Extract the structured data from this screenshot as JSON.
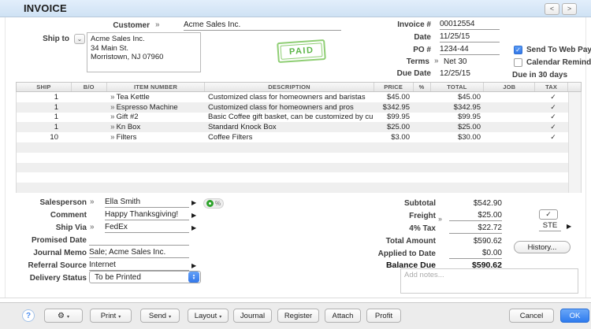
{
  "titlebar": {
    "title": "INVOICE"
  },
  "glyphs": {
    "zoom": "»",
    "detail": "▶",
    "caret": "▾",
    "chevron": "⌄",
    "check": "✓",
    "gear": "⚙",
    "percent": "%",
    "help": "?",
    "nav_prev": "<",
    "nav_next": ">",
    "step_up": "▲",
    "step_down": "▼"
  },
  "header": {
    "customer": {
      "label": "Customer",
      "value": "Acme Sales Inc."
    },
    "ship_to": {
      "label": "Ship to",
      "value": "Acme Sales Inc.\n34 Main St.\nMorristown, NJ 07960"
    },
    "paid_stamp": "PAID",
    "invoice_no": {
      "label": "Invoice #",
      "value": "00012554"
    },
    "date": {
      "label": "Date",
      "value": "11/25/15"
    },
    "po": {
      "label": "PO #",
      "value": "1234-44"
    },
    "terms": {
      "label": "Terms",
      "value": "Net 30"
    },
    "due_date": {
      "label": "Due Date",
      "value": "12/25/15"
    },
    "web_pay": {
      "label": "Send To Web Pay",
      "checked": true
    },
    "calendar": {
      "label": "Calendar Reminder",
      "checked": false
    },
    "due_note": "Due in 30 days"
  },
  "table": {
    "headers": [
      "SHIP",
      "B/O",
      "ITEM NUMBER",
      "DESCRIPTION",
      "PRICE",
      "%",
      "TOTAL",
      "JOB",
      "TAX"
    ],
    "rows": [
      {
        "ship": "1",
        "item": "Tea Kettle",
        "desc": "Customized class for homeowners and baristas",
        "price": "$45.00",
        "total": "$45.00",
        "tax": "✓"
      },
      {
        "ship": "1",
        "item": "Espresso Machine",
        "desc": "Customized class for homeowners and pros",
        "price": "$342.95",
        "total": "$342.95",
        "tax": "✓"
      },
      {
        "ship": "1",
        "item": "Gift #2",
        "desc": "Basic Coffee gift basket, can be customized by cu",
        "price": "$99.95",
        "total": "$99.95",
        "tax": "✓"
      },
      {
        "ship": "1",
        "item": "Kn Box",
        "desc": "Standard Knock Box",
        "price": "$25.00",
        "total": "$25.00",
        "tax": "✓"
      },
      {
        "ship": "10",
        "item": "Filters",
        "desc": "Coffee Filters",
        "price": "$3.00",
        "total": "$30.00",
        "tax": "✓"
      }
    ]
  },
  "details": {
    "salesperson": {
      "label": "Salesperson",
      "value": "Ella Smith"
    },
    "comment": {
      "label": "Comment",
      "value": "Happy Thanksgiving!"
    },
    "ship_via": {
      "label": "Ship Via",
      "value": "FedEx"
    },
    "promised_date": {
      "label": "Promised Date",
      "value": ""
    },
    "journal_memo": {
      "label": "Journal Memo",
      "value": "Sale; Acme Sales Inc."
    },
    "referral": {
      "label": "Referral Source",
      "value": "Internet"
    },
    "delivery": {
      "label": "Delivery Status",
      "value": "To be Printed"
    }
  },
  "totals": {
    "subtotal": {
      "label": "Subtotal",
      "value": "$542.90"
    },
    "freight": {
      "label": "Freight",
      "value": "$25.00"
    },
    "tax": {
      "label": "4% Tax",
      "value": "$22.72",
      "code": "STE"
    },
    "total_amount": {
      "label": "Total Amount",
      "value": "$590.62"
    },
    "applied": {
      "label": "Applied to Date",
      "value": "$0.00"
    },
    "balance": {
      "label": "Balance Due",
      "value": "$590.62"
    },
    "history_button": "History...",
    "notes_placeholder": "Add notes..."
  },
  "toolbar": {
    "print": "Print",
    "send": "Send",
    "layout": "Layout",
    "journal": "Journal",
    "register": "Register",
    "attach": "Attach",
    "profit": "Profit",
    "cancel": "Cancel",
    "ok": "OK"
  },
  "colors": {
    "accent_blue": "#3a86f0",
    "paid_green": "#6fc24f",
    "titlebar_blue": "#d9e8f7"
  }
}
